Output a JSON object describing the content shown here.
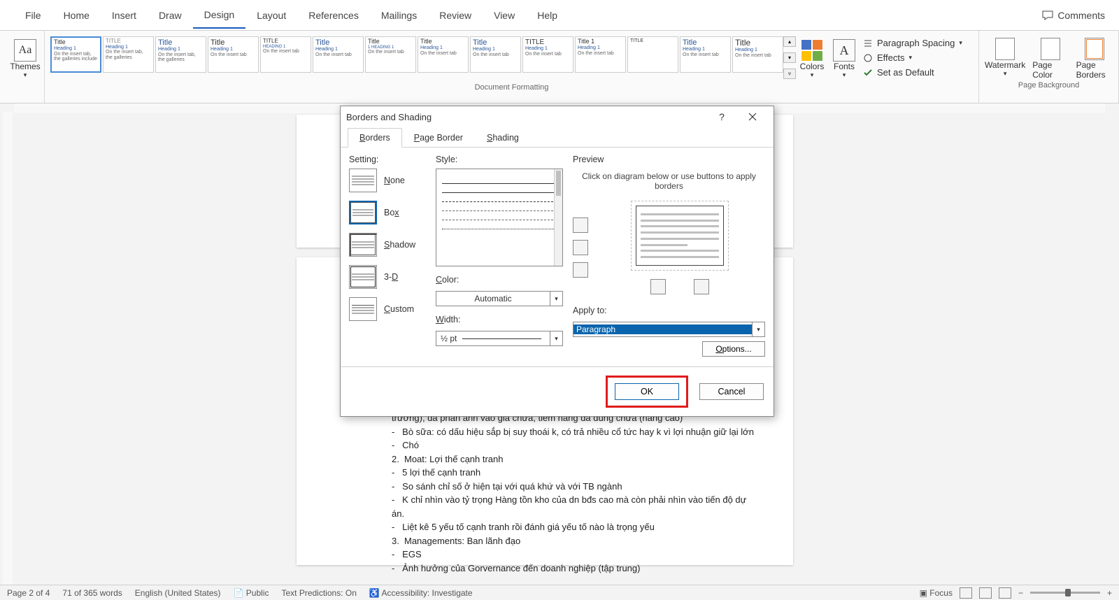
{
  "tabs": {
    "file": "File",
    "home": "Home",
    "insert": "Insert",
    "draw": "Draw",
    "design": "Design",
    "layout": "Layout",
    "references": "References",
    "mailings": "Mailings",
    "review": "Review",
    "view": "View",
    "help": "Help",
    "comments": "Comments"
  },
  "ribbon": {
    "themes": "Themes",
    "doc_formatting": "Document Formatting",
    "colors": "Colors",
    "fonts": "Fonts",
    "para_spacing": "Paragraph Spacing",
    "effects": "Effects",
    "set_default": "Set as Default",
    "watermark": "Watermark",
    "page_color": "Page Color",
    "page_borders": "Page Borders",
    "page_background": "Page Background"
  },
  "dialog": {
    "title": "Borders and Shading",
    "tabs": {
      "borders": "orders",
      "page_border": "age Border",
      "shading": "hading",
      "b": "B",
      "p": "P",
      "s": "S"
    },
    "setting": "Setting:",
    "settings": {
      "none": "one",
      "box": "x",
      "shadow": "hadow",
      "threeD": "3-",
      "d": "D",
      "custom": "ustom",
      "n": "N",
      "bo": "Bo",
      "s": "S",
      "c": "C"
    },
    "style": "Style:",
    "color": "Color:",
    "color_val": "Automatic",
    "width": "Width:",
    "width_val": "½ pt",
    "preview": "Preview",
    "preview_desc": "Click on diagram below or use buttons to apply borders",
    "apply_to": "Apply to:",
    "apply_val": "Paragraph",
    "options": "Options...",
    "ok": "OK",
    "cancel": "Cancel"
  },
  "document": {
    "l1": "trường), đã phản ánh vào giá chưa, tiềm năng đã dùng chưa (nâng cao)",
    "l2": "Bò sữa: có dấu hiệu sắp bị suy thoái k, có trả nhiều cổ tức hay k vì lợi nhuận giữ lại lớn",
    "l3": "Chó",
    "l4": "Moat: Lợi thế cạnh tranh",
    "l5": "5 lợi thế cạnh tranh",
    "l6": "So sánh chỉ số ở hiện tại với quá khứ và với TB ngành",
    "l7": "K chỉ nhìn vào tỷ trọng Hàng tồn kho của dn bđs cao mà còn phải nhìn vào tiến độ dự án.",
    "l8": "Liệt kê 5 yếu tố cạnh tranh rồi đánh giá yếu tố nào là trọng yếu",
    "l9": "Managements: Ban lãnh đạo",
    "l10": "EGS",
    "l11": "Ảnh hưởng của Gorvernance đến doanh nghiệp (tập trung)"
  },
  "status": {
    "page": "Page 2 of 4",
    "words": "71 of 365 words",
    "lang": "English (United States)",
    "public": "Public",
    "pred": "Text Predictions: On",
    "access": "Accessibility: Investigate",
    "focus": "Focus",
    "zoom_minus": "−",
    "zoom_plus": "+"
  }
}
